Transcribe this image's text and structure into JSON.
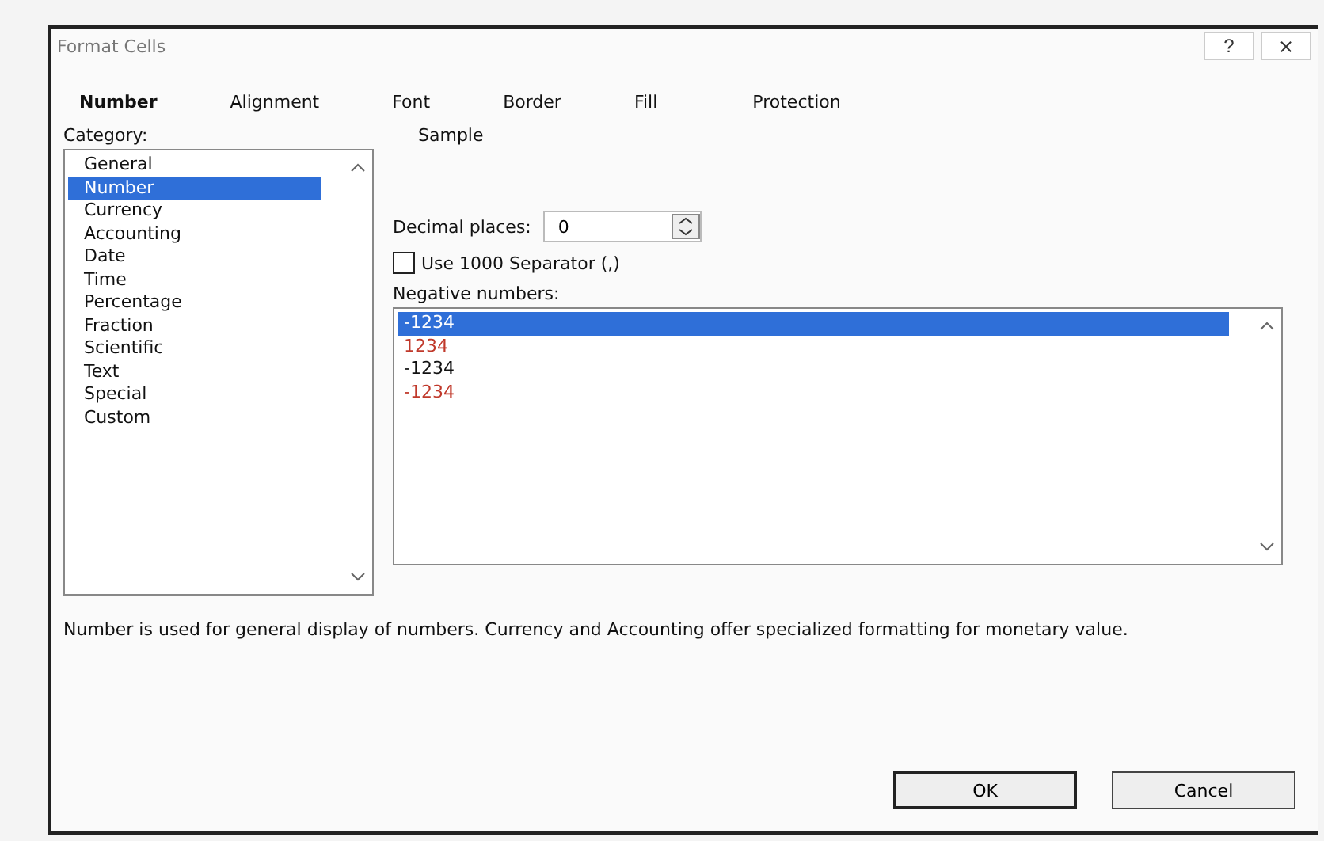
{
  "window": {
    "title": "Format Cells",
    "help": "?",
    "close": "⨯"
  },
  "tabs": [
    {
      "label": "Number",
      "selected": true
    },
    {
      "label": "Alignment",
      "selected": false
    },
    {
      "label": "Font",
      "selected": false
    },
    {
      "label": "Border",
      "selected": false
    },
    {
      "label": "Fill",
      "selected": false
    },
    {
      "label": "Protection",
      "selected": false
    }
  ],
  "category": {
    "label": "Category:",
    "items": [
      {
        "label": "General",
        "selected": false
      },
      {
        "label": "Number",
        "selected": true
      },
      {
        "label": "Currency",
        "selected": false
      },
      {
        "label": "Accounting",
        "selected": false
      },
      {
        "label": "Date",
        "selected": false
      },
      {
        "label": "Time",
        "selected": false
      },
      {
        "label": "Percentage",
        "selected": false
      },
      {
        "label": "Fraction",
        "selected": false
      },
      {
        "label": "Scientific",
        "selected": false
      },
      {
        "label": "Text",
        "selected": false
      },
      {
        "label": "Special",
        "selected": false
      },
      {
        "label": "Custom",
        "selected": false
      }
    ]
  },
  "sample": {
    "label": "Sample"
  },
  "decimal_places": {
    "label": "Decimal places:",
    "value": "0"
  },
  "thousands_separator": {
    "label": "Use 1000 Separator (,)",
    "checked": false
  },
  "negative_numbers": {
    "label": "Negative numbers:",
    "items": [
      {
        "label": "-1234",
        "selected": true
      },
      {
        "label": "1234",
        "selected": false,
        "color": "#c0392b"
      },
      {
        "label": "-1234",
        "selected": false
      },
      {
        "label": "-1234",
        "selected": false,
        "color": "#c0392b"
      }
    ]
  },
  "description": "Number is used for general display of numbers.  Currency and Accounting offer specialized formatting for monetary value.",
  "buttons": [
    {
      "label": "OK",
      "kind": "default"
    },
    {
      "label": "Cancel",
      "kind": "normal"
    }
  ]
}
